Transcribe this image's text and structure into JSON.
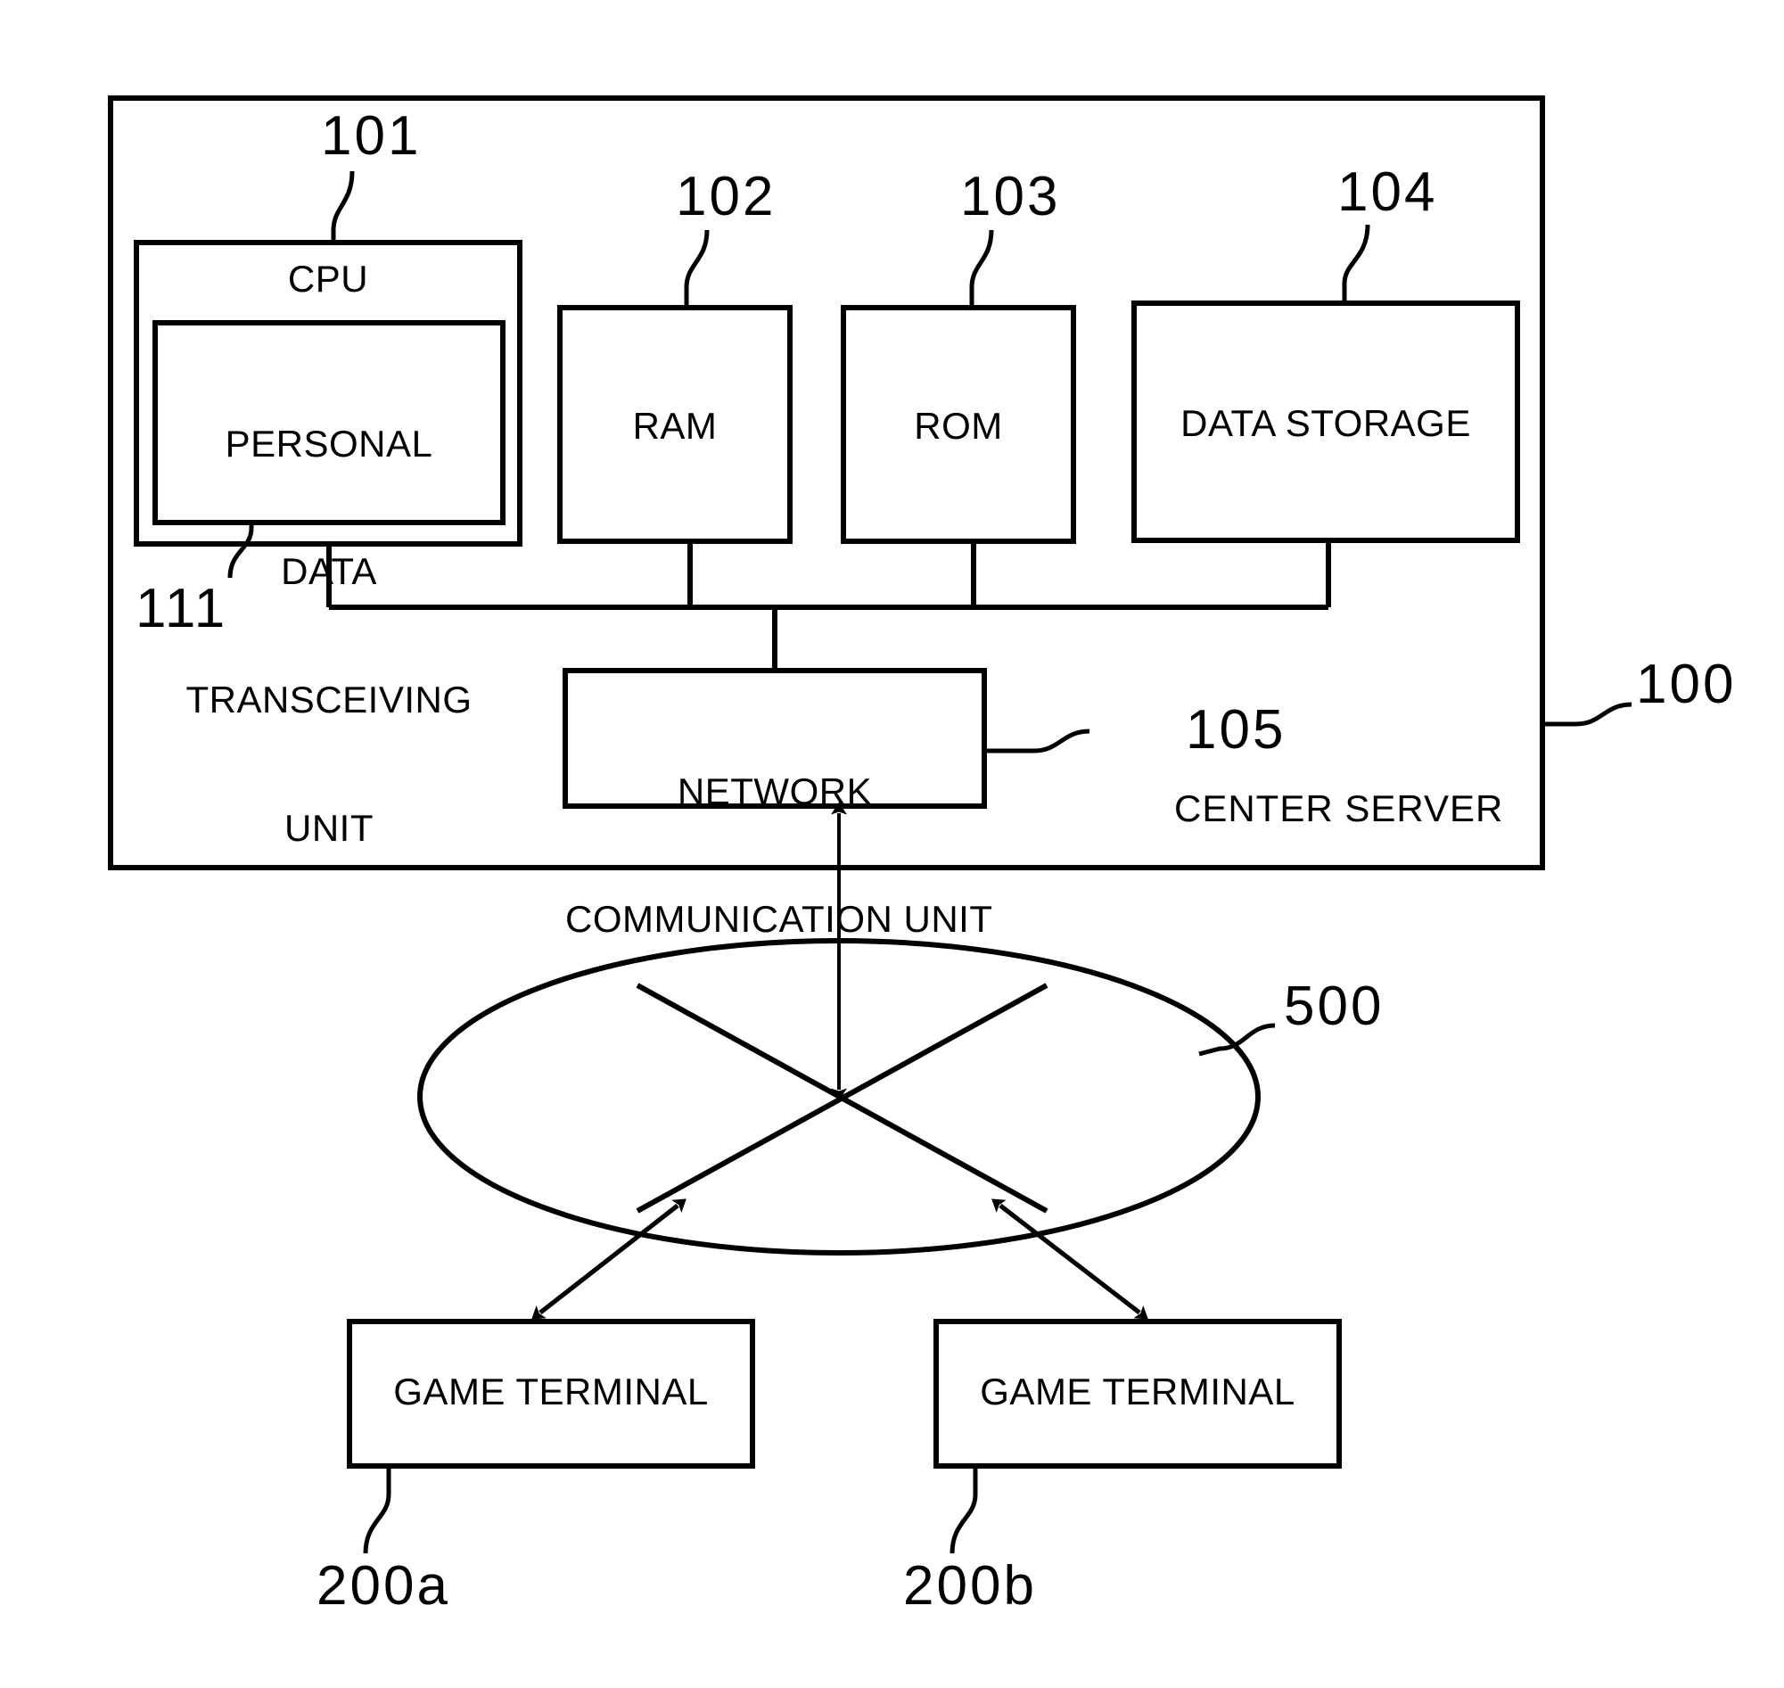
{
  "figure": {
    "type": "patent-block-diagram",
    "description": "Center server block diagram connected through a network to two game terminals"
  },
  "server": {
    "title": "CENTER SERVER",
    "ref": "100"
  },
  "cpu": {
    "label": "CPU",
    "ref": "101",
    "inner": {
      "line1": "PERSONAL",
      "line2": "DATA",
      "line3": "TRANSCEIVING",
      "line4": "UNIT",
      "ref": "111"
    }
  },
  "memory": {
    "ram": {
      "label": "RAM",
      "ref": "102"
    },
    "rom": {
      "label": "ROM",
      "ref": "103"
    },
    "storage": {
      "label": "DATA STORAGE",
      "ref": "104"
    }
  },
  "network_unit": {
    "line1": "NETWORK",
    "line2": "COMMUNICATION UNIT",
    "ref": "105"
  },
  "network": {
    "ref": "500"
  },
  "terminals": [
    {
      "label": "GAME TERMINAL",
      "ref": "200a"
    },
    {
      "label": "GAME TERMINAL",
      "ref": "200b"
    }
  ],
  "style": {
    "ink": "#000000",
    "paper": "#ffffff"
  }
}
